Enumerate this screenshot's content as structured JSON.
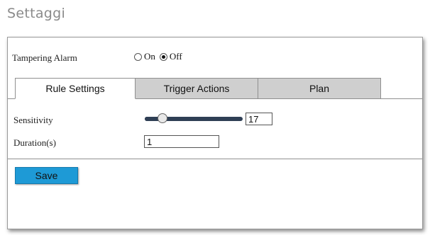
{
  "page": {
    "heading": "Settaggi"
  },
  "alarm": {
    "label": "Tampering Alarm",
    "options": [
      {
        "label": "On",
        "checked": false
      },
      {
        "label": "Off",
        "checked": true
      }
    ]
  },
  "tabs": [
    {
      "label": "Rule Settings",
      "active": true
    },
    {
      "label": "Trigger Actions",
      "active": false
    },
    {
      "label": "Plan",
      "active": false
    }
  ],
  "sensitivity": {
    "label": "Sensitivity",
    "value": "17",
    "slider_fraction": 0.18
  },
  "duration": {
    "label": "Duration(s)",
    "value": "1"
  },
  "buttons": {
    "save_label": "Save"
  },
  "colors": {
    "save_button": "#1e9ad6",
    "slider_track": "#2f3f55",
    "inactive_tab": "#cfcfcf"
  }
}
